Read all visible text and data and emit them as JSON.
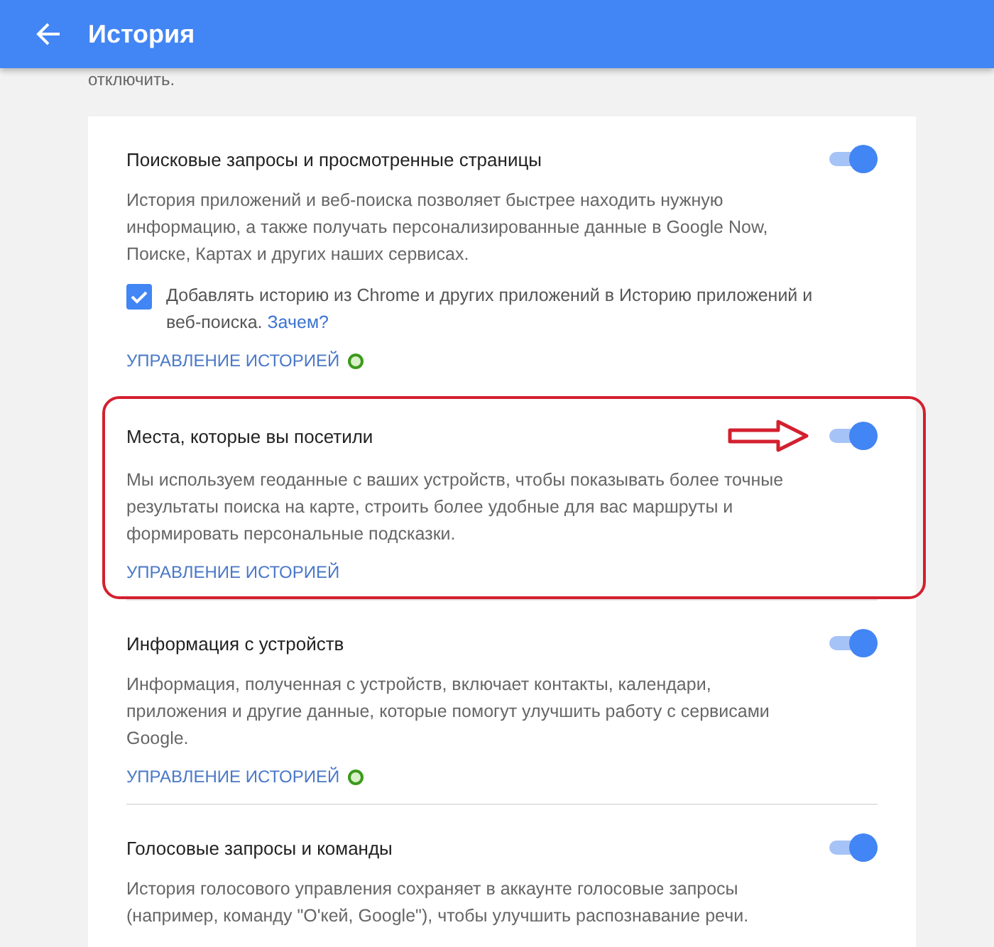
{
  "header": {
    "title": "История"
  },
  "intro_tail": "отключить.",
  "sections": [
    {
      "title": "Поисковые запросы и просмотренные страницы",
      "on": true,
      "highlighted": false,
      "description": "История приложений и веб-поиска позволяет быстрее находить нужную информацию, а также получать персонализированные данные в Google Now, Поиске, Картах и других наших сервисах.",
      "checkbox": {
        "checked": true,
        "label": "Добавлять историю из Chrome и других приложений в Историю приложений и веб-поиска.",
        "link": "Зачем?"
      },
      "manage_link": "УПРАВЛЕНИЕ ИСТОРИЕЙ",
      "status_dot": true
    },
    {
      "title": "Места, которые вы посетили",
      "on": true,
      "highlighted": true,
      "description": "Мы используем геоданные с ваших устройств, чтобы показывать более точные результаты поиска на карте, строить более удобные для вас маршруты и формировать персональные подсказки.",
      "manage_link": "УПРАВЛЕНИЕ ИСТОРИЕЙ",
      "status_dot": false
    },
    {
      "title": "Информация с устройств",
      "on": true,
      "highlighted": false,
      "description": "Информация, полученная с устройств, включает контакты, календари, приложения и другие данные, которые помогут улучшить работу с сервисами Google.",
      "manage_link": "УПРАВЛЕНИЕ ИСТОРИЕЙ",
      "status_dot": true
    },
    {
      "title": "Голосовые запросы и команды",
      "on": true,
      "highlighted": false,
      "description": "История голосового управления сохраняет в аккаунте голосовые запросы (например, команду \"О'кей, Google\"), чтобы улучшить распознавание речи."
    }
  ]
}
